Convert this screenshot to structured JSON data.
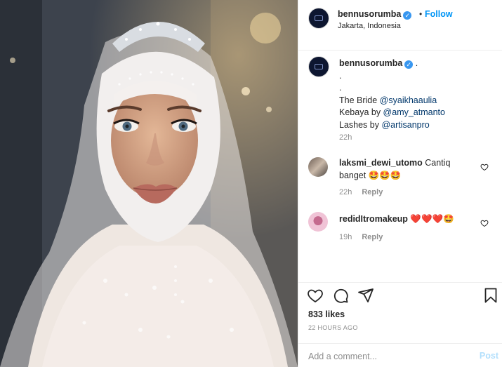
{
  "header": {
    "username": "bennusorumba",
    "separator": "•",
    "follow_label": "Follow",
    "location": "Jakarta, Indonesia"
  },
  "caption": {
    "username": "bennusorumba",
    "after_name": ".",
    "lines": [
      {
        "text": "."
      },
      {
        "text": "."
      },
      {
        "prefix": "The Bride ",
        "mention": "@syaikhaaulia"
      },
      {
        "prefix": "Kebaya by ",
        "mention": "@amy_atmanto"
      },
      {
        "prefix": "Lashes by ",
        "mention": "@artisanpro"
      }
    ],
    "time": "22h"
  },
  "comments": [
    {
      "username": "laksmi_dewi_utomo",
      "text": "Cantiq banget 🤩🤩🤩",
      "time": "22h",
      "reply_label": "Reply"
    },
    {
      "username": "redidItromakeup",
      "text": "❤️❤️❤️🤩",
      "time": "19h",
      "reply_label": "Reply"
    }
  ],
  "actions": {
    "likes": "833 likes",
    "posted": "22 HOURS AGO"
  },
  "add_comment": {
    "placeholder": "Add a comment...",
    "post_label": "Post"
  },
  "colors": {
    "link": "#0095f6",
    "mention": "#00376b",
    "muted": "#8e8e8e",
    "post_disabled": "#b2dffc",
    "verified": "#3897f0"
  },
  "icons": [
    "heart-icon",
    "comment-icon",
    "share-icon",
    "bookmark-icon",
    "verified-badge-icon"
  ]
}
